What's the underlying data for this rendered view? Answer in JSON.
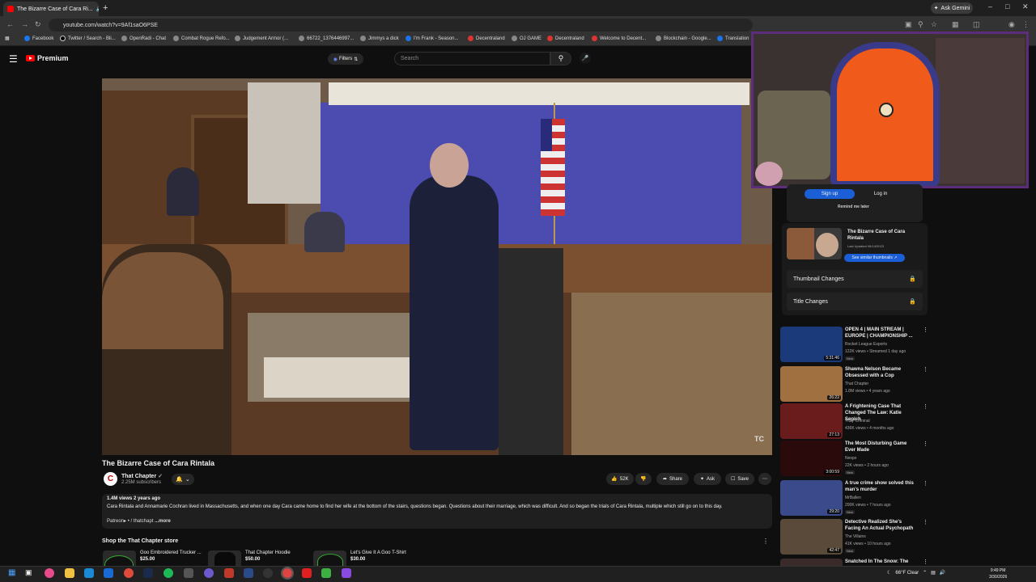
{
  "browser": {
    "tab_title": "The Bizarre Case of Cara Ri...",
    "new_tab_label": "+",
    "ask_gemini": "Ask Gemini",
    "url": "youtube.com/watch?v=9Af1saO6PSE",
    "bookmarks": [
      "Facebook",
      "Twitter / Search - Bli...",
      "OpenRadi - Chat",
      "Combat Rogue Refo...",
      "Judgement Armor (...",
      "66722_1376446997...",
      "Jimmys a dick",
      "I'm Frank - Season...",
      "Decentraland",
      "OJ GAME",
      "Decentraland",
      "Welcome to Decent...",
      "Blockchain - Google...",
      "Translation"
    ]
  },
  "youtube": {
    "brand": "Premium",
    "filters_label": "Filters",
    "search_placeholder": "Search"
  },
  "video": {
    "watermark": "TC",
    "title": "The Bizarre Case of Cara Rintala",
    "channel_initial": "C",
    "channel_name": "That Chapter",
    "subscribers": "2.25M subscribers",
    "likes": "52K",
    "share_label": "Share",
    "ask_label": "Ask",
    "save_label": "Save",
    "views_line": "1.4M views  2 years ago",
    "description": "Cara Rintala and Annamarie Cochran lived in Massachusetts, and when one day Cara came home to find her wife at the bottom of the stairs, questions began. Questions about their marriage, which was difficult. And so began the trials of Cara Rintala, multiple which still go on to this day.",
    "patreon_line": "Patreon▸  • / thatchapt",
    "more_label": "...more"
  },
  "store": {
    "heading": "Shop the That Chapter store",
    "products": [
      {
        "name": "Goo Embroidered Trucker ...",
        "price": "$25.00"
      },
      {
        "name": "That Chapter Hoodie",
        "price": "$50.00"
      },
      {
        "name": "Let's Give It A Goo T-Shirt",
        "price": "$30.00"
      }
    ]
  },
  "sidebar": {
    "signup_label": "Sign up",
    "login_label": "Log in",
    "remind_label": "Remind me later",
    "thumb_title": "The Bizarre Case of Cara Rintala",
    "thumb_date": "Last Updated 06/14/2023",
    "similar_button": "See similar thumbnails ↗",
    "thumbnail_changes": "Thumbnail Changes",
    "title_changes": "Title Changes"
  },
  "recommendations": [
    {
      "title": "OPEN 4 | MAIN STREAM | EUROPE | CHAMPIONSHIP ...",
      "channel": "Rocket League Esports",
      "meta": "122K views • Streamed 1 day ago",
      "duration": "5:31:46",
      "badge": "New",
      "color": "#1b3a7a"
    },
    {
      "title": "Shawna Nelson Became Obsessed with a Cop",
      "channel": "That Chapter",
      "meta": "1.8M views • 4 years ago",
      "duration": "26:22",
      "badge": "",
      "color": "#a07040"
    },
    {
      "title": "A Frightening Case That Changed The Law: Katie Sepich",
      "channel": "Truly Criminal",
      "meta": "436K views • 4 months ago",
      "duration": "27:13",
      "badge": "",
      "color": "#6a1b1b"
    },
    {
      "title": "The Most Disturbing Game Ever Made",
      "channel": "Nexpo",
      "meta": "22K views • 2 hours ago",
      "duration": "3:00:59",
      "badge": "New",
      "color": "#2a0a0a"
    },
    {
      "title": "A true crime show solved this man's murder",
      "channel": "MrBallen",
      "meta": "200K views • 7 hours ago",
      "duration": "29:20",
      "badge": "New",
      "color": "#3a4a8a"
    },
    {
      "title": "Detective Realized She's Facing An Actual Psychopath",
      "channel": "The Villains",
      "meta": "41K views • 10 hours ago",
      "duration": "42:47",
      "badge": "New",
      "color": "#5a4a3a"
    },
    {
      "title": "Snatched In The Snow: The",
      "channel": "",
      "meta": "",
      "duration": "",
      "badge": "",
      "color": "#3a2a2a"
    }
  ],
  "taskbar": {
    "weather": "66°F  Clear",
    "time": "9:49 PM",
    "date": "3/30/2026"
  }
}
